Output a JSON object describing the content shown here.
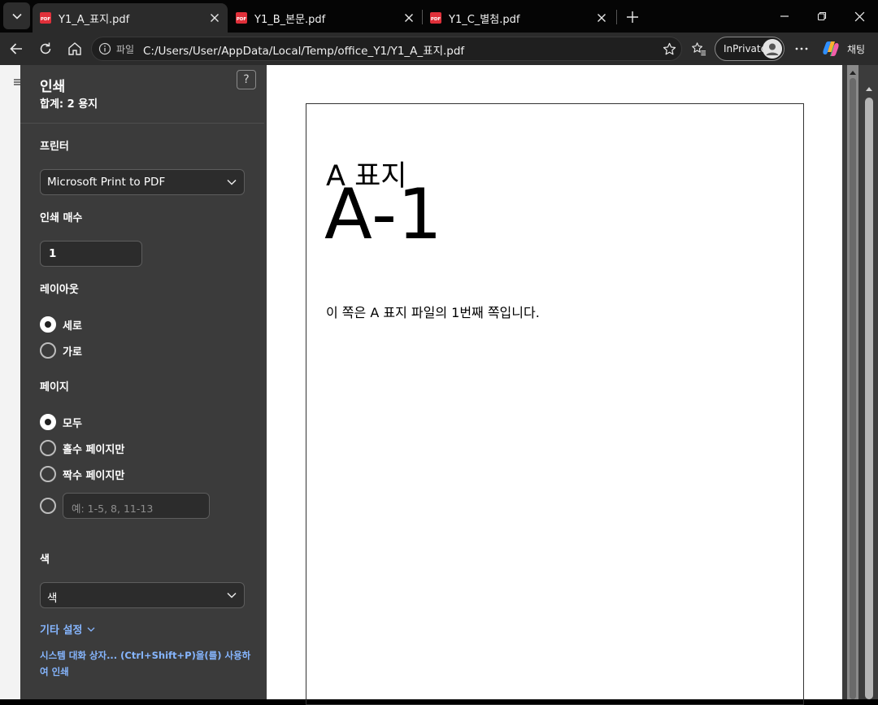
{
  "tabs": [
    {
      "title": "Y1_A_표지.pdf",
      "active": true
    },
    {
      "title": "Y1_B_본문.pdf",
      "active": false
    },
    {
      "title": "Y1_C_별첨.pdf",
      "active": false
    }
  ],
  "address_bar": {
    "scheme_label": "파일",
    "url": "C:/Users/User/AppData/Local/Temp/office_Y1/Y1_A_표지.pdf"
  },
  "toolbar": {
    "inprivate_label": "InPrivate",
    "copilot_label": "채팅"
  },
  "print_panel": {
    "title": "인쇄",
    "total": "합계: 2 용지",
    "help": "?",
    "printer": {
      "label": "프린터",
      "value": "Microsoft Print to PDF"
    },
    "copies": {
      "label": "인쇄 매수",
      "value": "1"
    },
    "layout": {
      "label": "레이아웃",
      "options": [
        "세로",
        "가로"
      ],
      "selected": "세로"
    },
    "pages": {
      "label": "페이지",
      "options": [
        "모두",
        "홀수 페이지만",
        "짝수 페이지만"
      ],
      "selected": "모두",
      "custom_placeholder": "예: 1-5, 8, 11-13"
    },
    "color": {
      "label": "색",
      "value": "색"
    },
    "more_settings": "기타 설정",
    "system_dialog": "시스템 대화 상자... (Ctrl+Shift+P)을(를) 사용하여 인쇄"
  },
  "preview": {
    "heading_small": "A 표지",
    "heading_big": "A-1",
    "body": "이 쪽은 A 표지 파일의 1번째 쪽입니다."
  },
  "colors": {
    "accent_link": "#86b6ff",
    "panel_bg": "#3b3b3b",
    "pdf_icon": "#e0303a"
  }
}
